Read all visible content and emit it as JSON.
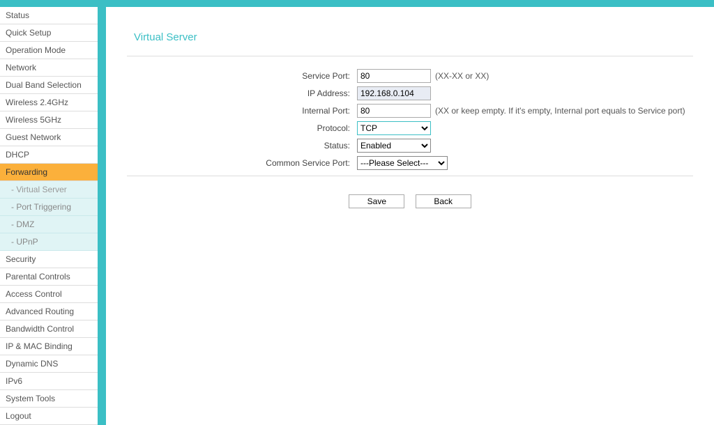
{
  "page_title": "Virtual Server",
  "sidebar": {
    "items": [
      {
        "label": "Status",
        "active": false
      },
      {
        "label": "Quick Setup",
        "active": false
      },
      {
        "label": "Operation Mode",
        "active": false
      },
      {
        "label": "Network",
        "active": false
      },
      {
        "label": "Dual Band Selection",
        "active": false
      },
      {
        "label": "Wireless 2.4GHz",
        "active": false
      },
      {
        "label": "Wireless 5GHz",
        "active": false
      },
      {
        "label": "Guest Network",
        "active": false
      },
      {
        "label": "DHCP",
        "active": false
      },
      {
        "label": "Forwarding",
        "active": true,
        "subs": [
          {
            "label": "- Virtual Server"
          },
          {
            "label": "- Port Triggering"
          },
          {
            "label": "- DMZ"
          },
          {
            "label": "- UPnP"
          }
        ]
      },
      {
        "label": "Security",
        "active": false
      },
      {
        "label": "Parental Controls",
        "active": false
      },
      {
        "label": "Access Control",
        "active": false
      },
      {
        "label": "Advanced Routing",
        "active": false
      },
      {
        "label": "Bandwidth Control",
        "active": false
      },
      {
        "label": "IP & MAC Binding",
        "active": false
      },
      {
        "label": "Dynamic DNS",
        "active": false
      },
      {
        "label": "IPv6",
        "active": false
      },
      {
        "label": "System Tools",
        "active": false
      },
      {
        "label": "Logout",
        "active": false
      }
    ]
  },
  "form": {
    "service_port": {
      "label": "Service Port:",
      "value": "80",
      "hint": "(XX-XX or XX)"
    },
    "ip_address": {
      "label": "IP Address:",
      "value": "192.168.0.104"
    },
    "internal_port": {
      "label": "Internal Port:",
      "value": "80",
      "hint": "(XX or keep empty. If it's empty, Internal port equals to Service port)"
    },
    "protocol": {
      "label": "Protocol:",
      "value": "TCP"
    },
    "status": {
      "label": "Status:",
      "value": "Enabled"
    },
    "common_port": {
      "label": "Common Service Port:",
      "value": "---Please Select---"
    }
  },
  "buttons": {
    "save": "Save",
    "back": "Back"
  }
}
